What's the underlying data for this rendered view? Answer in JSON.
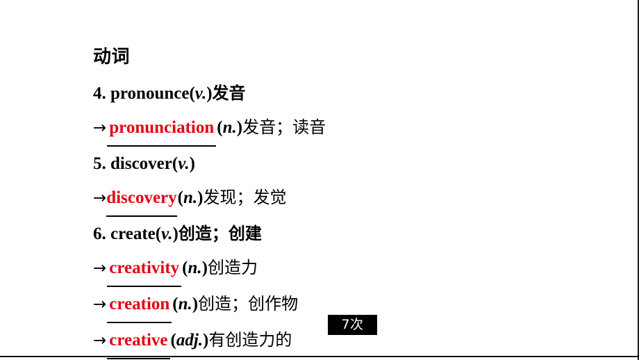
{
  "slide": {
    "heading": "动词",
    "background_color": "#FFFFFF",
    "answer_color": "#E50012",
    "text_color": "#000000"
  },
  "entries": [
    {
      "index": "4.",
      "headword": "pronounce",
      "headword_pos_open": "(",
      "headword_pos": "v.",
      "headword_pos_close": ")",
      "headword_gloss": "发音",
      "arrow": "→",
      "answer": "pronunciation",
      "answer_pos_open": "(",
      "answer_pos": "n.",
      "answer_pos_close": ")",
      "answer_gloss": "发音；读音"
    },
    {
      "index": "5.",
      "headword": "discover",
      "headword_pos_open": "(",
      "headword_pos": "v.",
      "headword_pos_close": ")",
      "headword_gloss": "",
      "arrow": "→",
      "answer": "discovery",
      "answer_pos_open": "(",
      "answer_pos": "n.",
      "answer_pos_close": ")",
      "answer_gloss": "发现；发觉"
    },
    {
      "index": "6.",
      "headword": "create",
      "headword_pos_open": "(",
      "headword_pos": "v.",
      "headword_pos_close": ")",
      "headword_gloss": "创造；创建",
      "arrow": "→",
      "answer": "creativity",
      "answer_pos_open": "(",
      "answer_pos": "n.",
      "answer_pos_close": ")",
      "answer_gloss": "创造力"
    }
  ],
  "extra_derivations": [
    {
      "arrow": "→",
      "answer": "creation",
      "pos_open": "(",
      "pos": "n.",
      "pos_close": ")",
      "gloss": "创造；创作物"
    },
    {
      "arrow": "→",
      "answer": "creative",
      "pos_open": "(",
      "pos": "adj.",
      "pos_close": ")",
      "gloss": "有创造力的"
    }
  ],
  "badge": {
    "label": "7次"
  }
}
